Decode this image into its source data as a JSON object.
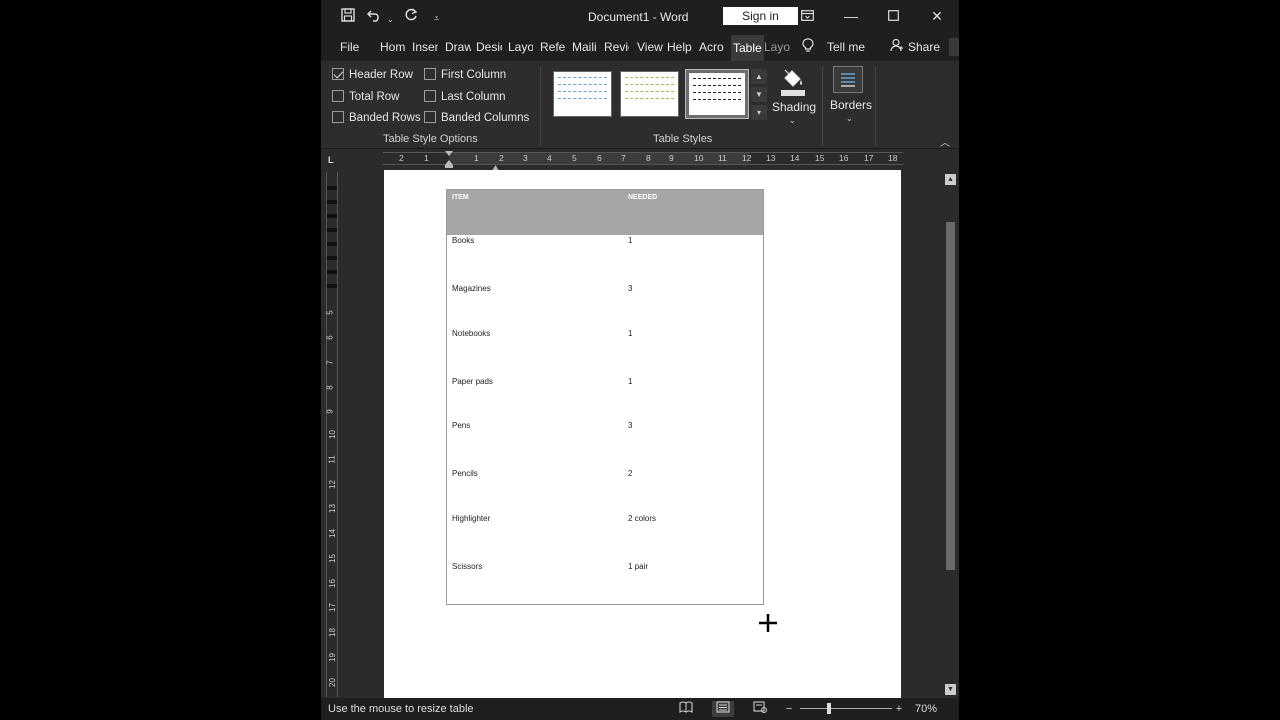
{
  "window": {
    "title": "Document1  -  Word",
    "sign_in_label": "Sign in"
  },
  "qat": {
    "save_icon": "save-icon",
    "undo_icon": "undo-icon",
    "redo_icon": "redo-icon"
  },
  "tabs": [
    {
      "label": "File"
    },
    {
      "label": "Hom"
    },
    {
      "label": "Inser"
    },
    {
      "label": "Draw"
    },
    {
      "label": "Desic"
    },
    {
      "label": "Layo"
    },
    {
      "label": "Refer"
    },
    {
      "label": "Maili"
    },
    {
      "label": "Revie"
    },
    {
      "label": "View"
    },
    {
      "label": "Help"
    },
    {
      "label": "Acro"
    },
    {
      "label": "Table"
    },
    {
      "label": "Layo"
    }
  ],
  "tell_me": "Tell me",
  "share": "Share",
  "ribbon": {
    "options": {
      "header_row": "Header Row",
      "total_row": "Total Row",
      "banded_rows": "Banded Rows",
      "first_column": "First Column",
      "last_column": "Last Column",
      "banded_columns": "Banded Columns"
    },
    "style_options_label": "Table Style Options",
    "styles_label": "Table Styles",
    "shading_label": "Shading",
    "borders_label": "Borders"
  },
  "ruler": {
    "corner": "L",
    "h_numbers": [
      "2",
      "1",
      "1",
      "2",
      "3",
      "4",
      "5",
      "6",
      "7",
      "8",
      "9",
      "10",
      "11",
      "12",
      "13",
      "14",
      "15",
      "16",
      "17",
      "18"
    ],
    "v_numbers": [
      "5",
      "6",
      "7",
      "8",
      "9",
      "10",
      "11",
      "12",
      "13",
      "14",
      "15",
      "16",
      "17",
      "18",
      "19",
      "20"
    ]
  },
  "table": {
    "headers": [
      "ITEM",
      "NEEDED"
    ],
    "rows": [
      {
        "item": "Books",
        "needed": "1"
      },
      {
        "item": "Magazines",
        "needed": "3"
      },
      {
        "item": "Notebooks",
        "needed": "1"
      },
      {
        "item": "Paper pads",
        "needed": "1"
      },
      {
        "item": "Pens",
        "needed": "3"
      },
      {
        "item": "Pencils",
        "needed": "2"
      },
      {
        "item": "Highlighter",
        "needed": "2 colors"
      },
      {
        "item": "Scissors",
        "needed": "1 pair"
      }
    ]
  },
  "status": {
    "message": "Use the mouse to resize table",
    "zoom": "70%"
  }
}
